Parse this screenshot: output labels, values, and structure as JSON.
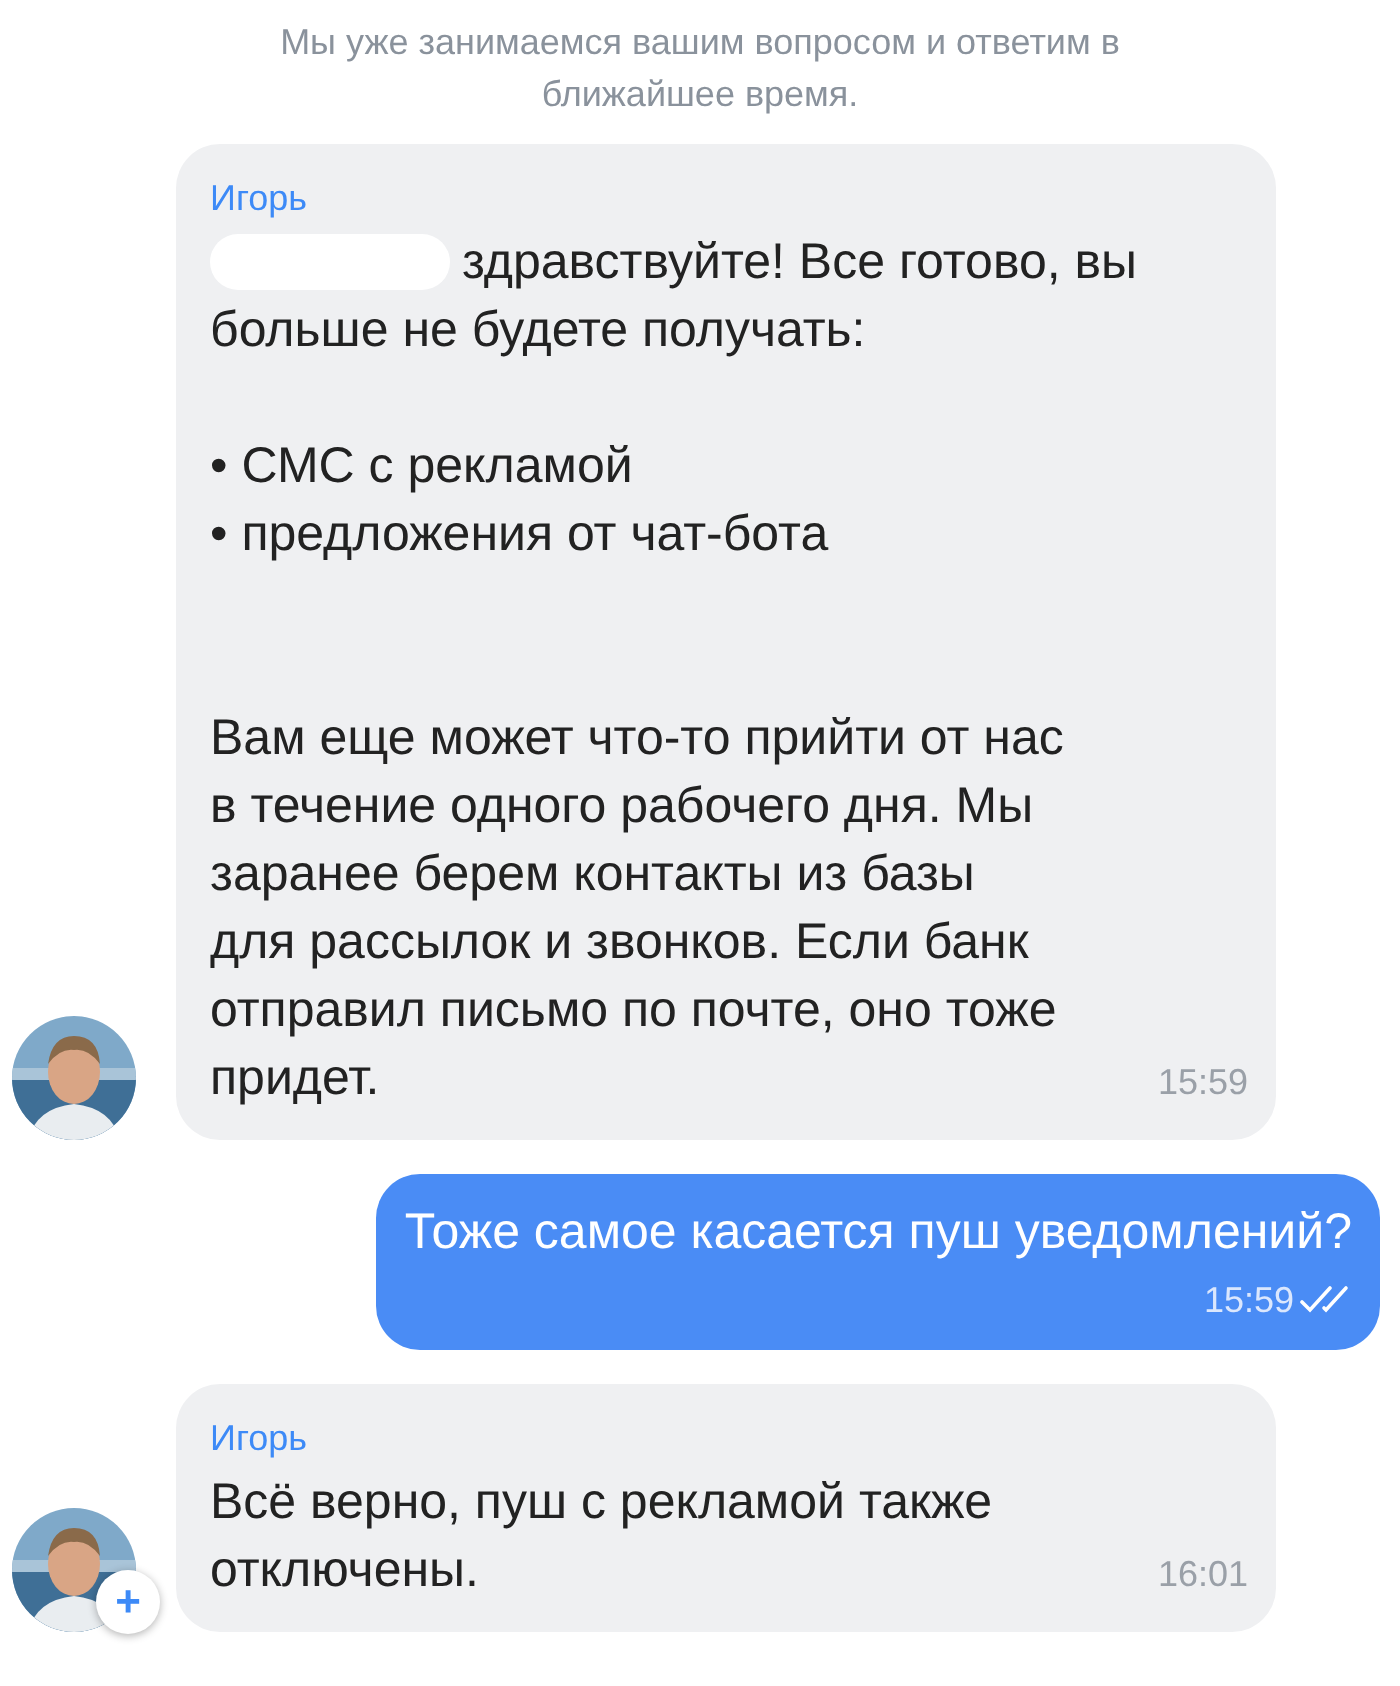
{
  "system_notice": "Мы уже занимаемся вашим вопросом и ответим в\nближайшее время.",
  "messages": [
    {
      "kind": "incoming",
      "sender": "Игорь",
      "redacted": true,
      "text": "здравствуйте! Все готово, вы\nбольше не будете получать:\n\n• СМС с рекламой\n• предложения от чат-бота\n\n\nВам еще может что-то прийти от нас\nв течение одного рабочего дня. Мы\nзаранее берем контакты из базы\nдля рассылок и звонков. Если банк\nотправил письмо по почте, оно тоже\nпридет.",
      "time": "15:59"
    },
    {
      "kind": "outgoing",
      "text": "Тоже самое касается пуш уведомлений?",
      "time": "15:59",
      "read": true
    },
    {
      "kind": "incoming",
      "sender": "Игорь",
      "text": "Всё верно, пуш с рекламой также\nотключены.",
      "time": "16:01",
      "avatar": {
        "kind": "picture",
        "badge": "+"
      }
    }
  ]
}
